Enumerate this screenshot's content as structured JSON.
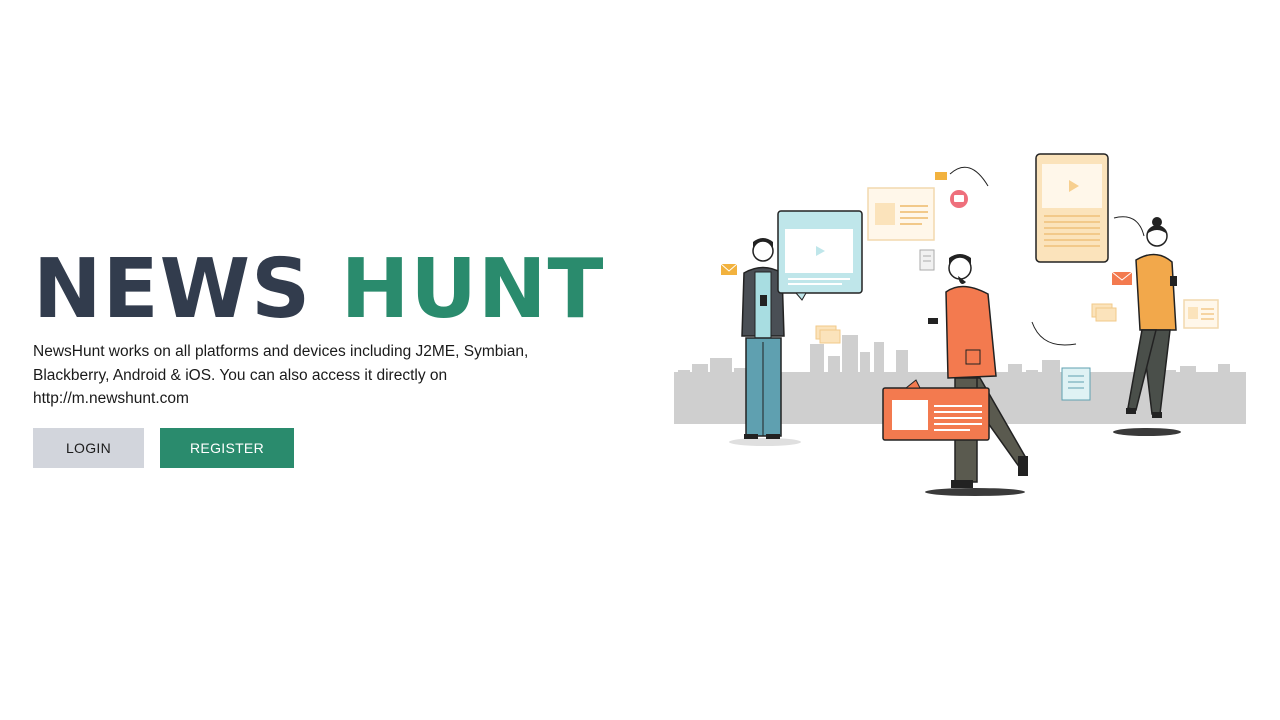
{
  "hero": {
    "title_part1": "NEWS",
    "title_part2": "HUNT",
    "description": "NewsHunt works on all platforms and devices including J2ME, Symbian, Blackberry, Android & iOS. You can also access it directly on http://m.newshunt.com"
  },
  "actions": {
    "login_label": "LOGIN",
    "register_label": "REGISTER"
  },
  "theme": {
    "title_dark": "#323c4d",
    "brand_green": "#2a8b6d",
    "login_bg": "#d2d5dc",
    "accent_orange": "#f37a4f",
    "accent_teal": "#bfe6ea",
    "accent_cream": "#fbe3bb"
  },
  "illustration": {
    "icons": [
      "envelope-icon",
      "play-icon",
      "article-card-icon",
      "scroll-icon",
      "chat-bubble-icon"
    ]
  }
}
